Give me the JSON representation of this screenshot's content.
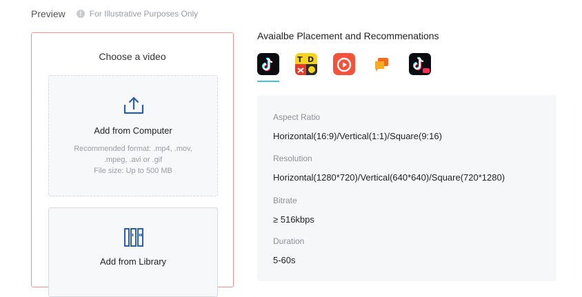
{
  "preview": {
    "title": "Preview",
    "info_text": "For Illustrative Purposes Only"
  },
  "upload": {
    "title": "Choose a video",
    "computer": {
      "label": "Add from Computer",
      "hint_line1": "Recommended format: .mp4, .mov,",
      "hint_line2": ".mpeg, .avi or .gif",
      "hint_line3": "File size: Up to 500 MB"
    },
    "library": {
      "label": "Add from Library"
    }
  },
  "placements": {
    "title": "Avaialbe Placement and Recommenations",
    "icons": [
      "tiktok-icon",
      "topbuzz-icon",
      "buzzvideo-icon",
      "babe-news-icon",
      "tiktok-lite-icon"
    ],
    "active_index": 0,
    "accent_color": "#46c2d6"
  },
  "specs": {
    "aspect_ratio": {
      "label": "Aspect Ratio",
      "value": "Horizontal(16:9)/Vertical(1:1)/Square(9:16)"
    },
    "resolution": {
      "label": "Resolution",
      "value": "Horizontal(1280*720)/Vertical(640*640)/Square(720*1280)"
    },
    "bitrate": {
      "label": "Bitrate",
      "value": "≥ 516kbps"
    },
    "duration": {
      "label": "Duration",
      "value": "5-60s"
    }
  },
  "colors": {
    "panel_border": "#f08f8f",
    "icon_blue": "#2f5fa3"
  }
}
